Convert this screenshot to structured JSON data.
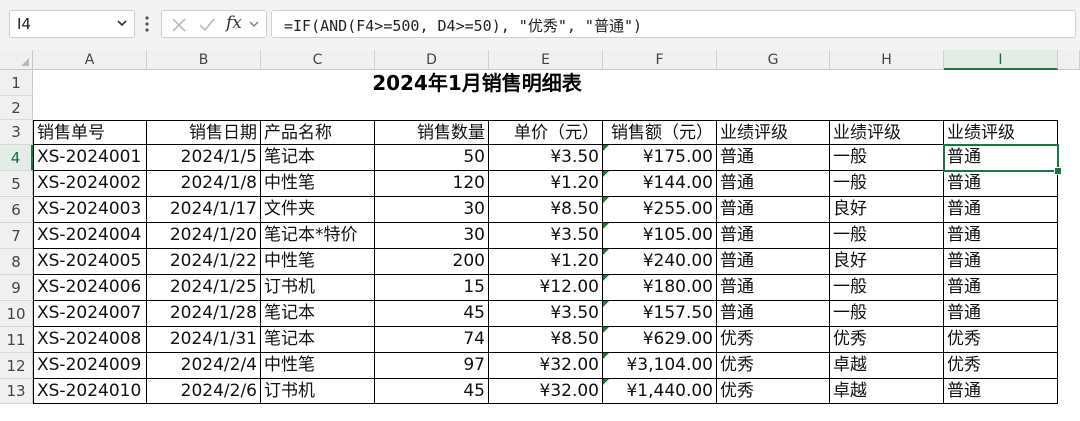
{
  "formula_bar": {
    "name_box": "I4",
    "fx_label": "fx",
    "formula": "=IF(AND(F4>=500, D4>=50), \"优秀\", \"普通\")"
  },
  "sheet": {
    "selected_cell": "I4",
    "columns": [
      "A",
      "B",
      "C",
      "D",
      "E",
      "F",
      "G",
      "H",
      "I"
    ],
    "rows": [
      "1",
      "2",
      "3",
      "4",
      "5",
      "6",
      "7",
      "8",
      "9",
      "10",
      "11",
      "12",
      "13"
    ],
    "title": "2024年1月销售明细表",
    "headers": [
      "销售单号",
      "销售日期",
      "产品名称",
      "销售数量",
      "单价（元）",
      "销售额（元）",
      "业绩评级",
      "业绩评级",
      "业绩评级"
    ],
    "data": [
      [
        "XS-2024001",
        "2024/1/5",
        "笔记本",
        "50",
        "¥3.50",
        "¥175.00",
        "普通",
        "一般",
        "普通"
      ],
      [
        "XS-2024002",
        "2024/1/8",
        "中性笔",
        "120",
        "¥1.20",
        "¥144.00",
        "普通",
        "一般",
        "普通"
      ],
      [
        "XS-2024003",
        "2024/1/17",
        "文件夹",
        "30",
        "¥8.50",
        "¥255.00",
        "普通",
        "良好",
        "普通"
      ],
      [
        "XS-2024004",
        "2024/1/20",
        "笔记本*特价",
        "30",
        "¥3.50",
        "¥105.00",
        "普通",
        "一般",
        "普通"
      ],
      [
        "XS-2024005",
        "2024/1/22",
        "中性笔",
        "200",
        "¥1.20",
        "¥240.00",
        "普通",
        "良好",
        "普通"
      ],
      [
        "XS-2024006",
        "2024/1/25",
        "订书机",
        "15",
        "¥12.00",
        "¥180.00",
        "普通",
        "一般",
        "普通"
      ],
      [
        "XS-2024007",
        "2024/1/28",
        "笔记本",
        "45",
        "¥3.50",
        "¥157.50",
        "普通",
        "一般",
        "普通"
      ],
      [
        "XS-2024008",
        "2024/1/31",
        "笔记本",
        "74",
        "¥8.50",
        "¥629.00",
        "优秀",
        "优秀",
        "优秀"
      ],
      [
        "XS-2024009",
        "2024/2/4",
        "中性笔",
        "97",
        "¥32.00",
        "¥3,104.00",
        "优秀",
        "卓越",
        "优秀"
      ],
      [
        "XS-2024010",
        "2024/2/6",
        "订书机",
        "45",
        "¥32.00",
        "¥1,440.00",
        "优秀",
        "卓越",
        "普通"
      ]
    ]
  },
  "colors": {
    "accent": "#217346",
    "header_bg": "#f0f0f0",
    "selected_header_bg": "#e3ece5",
    "formula_bar_bg": "#f3f3f3"
  }
}
